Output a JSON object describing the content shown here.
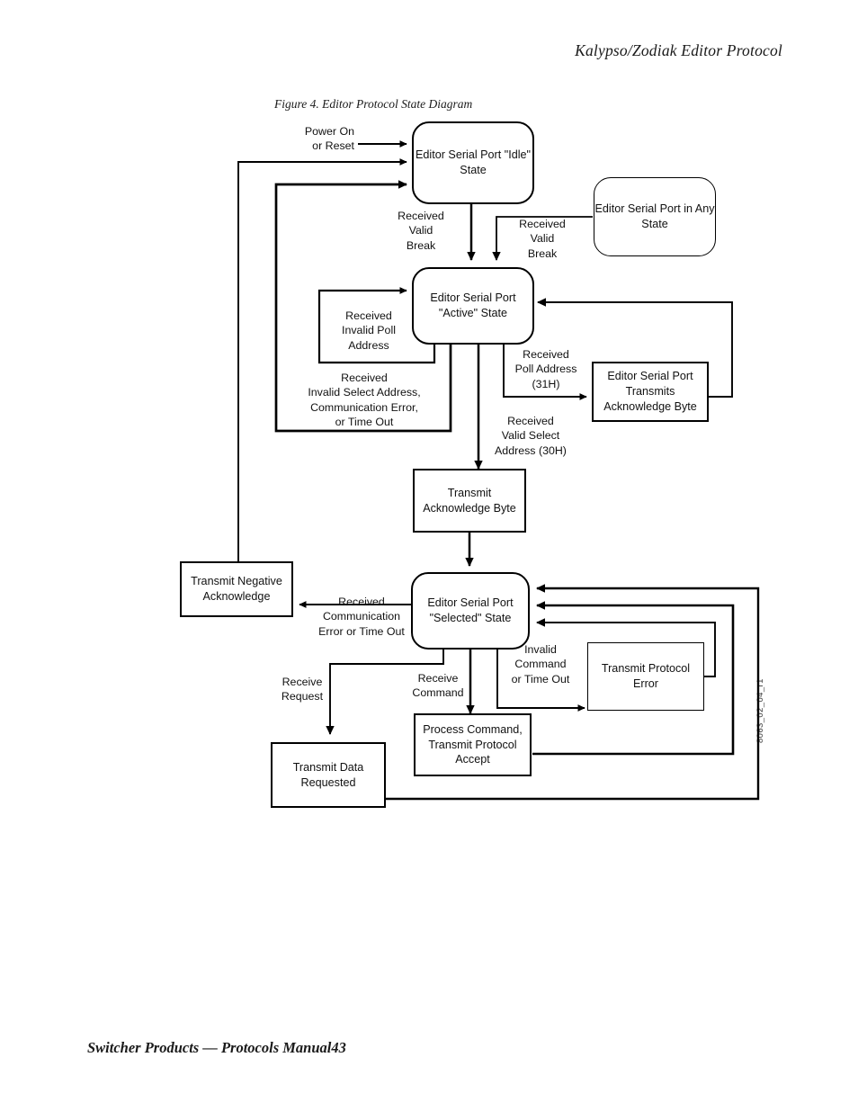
{
  "page": {
    "header_title": "Kalypso/Zodiak Editor Protocol",
    "footer": "Switcher Products  —  Protocols Manual43",
    "figure_caption": "Figure 4.  Editor Protocol State Diagram",
    "side_code": "8063_02_04_r1",
    "ink_color": "#000000",
    "background_color": "#ffffff"
  },
  "diagram": {
    "type": "state-diagram",
    "title": "Editor Protocol State Diagram",
    "nodes": [
      {
        "id": "idle",
        "label": "Editor Serial Port\n\"Idle\" State",
        "shape": "rounded-state"
      },
      {
        "id": "any",
        "label": "Editor Serial Port\nin Any State",
        "shape": "rounded-state"
      },
      {
        "id": "active",
        "label": "Editor Serial Port\n\"Active\" State",
        "shape": "rounded-state"
      },
      {
        "id": "ackbyte",
        "label": "Editor Serial Port\nTransmits\nAcknowledge Byte",
        "shape": "rect-process"
      },
      {
        "id": "txack",
        "label": "Transmit\nAcknowledge Byte",
        "shape": "rect-process"
      },
      {
        "id": "txnak",
        "label": "Transmit\nNegative\nAcknowledge",
        "shape": "rect-process"
      },
      {
        "id": "selected",
        "label": "Editor Serial Port\n\"Selected\" State",
        "shape": "rounded-state"
      },
      {
        "id": "txproterr",
        "label": "Transmit\nProtocol Error",
        "shape": "rect-process"
      },
      {
        "id": "proccmd",
        "label": "Process Command,\nTransmit\nProtocol Accept",
        "shape": "rect-process"
      },
      {
        "id": "txdata",
        "label": "Transmit Data\nRequested",
        "shape": "rect-process"
      }
    ],
    "edge_labels": [
      {
        "id": "poweron",
        "text": "Power On\nor Reset",
        "from": "start",
        "to": "idle"
      },
      {
        "id": "break1",
        "text": "Received\nValid\nBreak",
        "from": "idle",
        "to": "active"
      },
      {
        "id": "break2",
        "text": "Received\nValid\nBreak",
        "from": "any",
        "to": "active"
      },
      {
        "id": "invalidpoll",
        "text": "Received\nInvalid Poll\nAddress",
        "from": "active",
        "to": "active"
      },
      {
        "id": "invalidsel",
        "text": "Received\nInvalid Select Address,\nCommunication Error,\nor Time Out",
        "from": "active",
        "to": "idle"
      },
      {
        "id": "polladdr",
        "text": "Received\nPoll Address\n(31H)",
        "from": "active",
        "to": "ackbyte"
      },
      {
        "id": "validsel",
        "text": "Received\nValid Select\nAddress (30H)",
        "from": "active",
        "to": "txack"
      },
      {
        "id": "commerr",
        "text": "Received\nCommunication\nError or Time Out",
        "from": "selected",
        "to": "txnak"
      },
      {
        "id": "recvreq",
        "text": "Receive\nRequest",
        "from": "selected",
        "to": "txdata"
      },
      {
        "id": "recvcmd",
        "text": "Receive\nCommand",
        "from": "selected",
        "to": "proccmd"
      },
      {
        "id": "invalidcmd",
        "text": "Invalid\nCommand\nor Time Out",
        "from": "selected",
        "to": "txproterr"
      }
    ]
  }
}
